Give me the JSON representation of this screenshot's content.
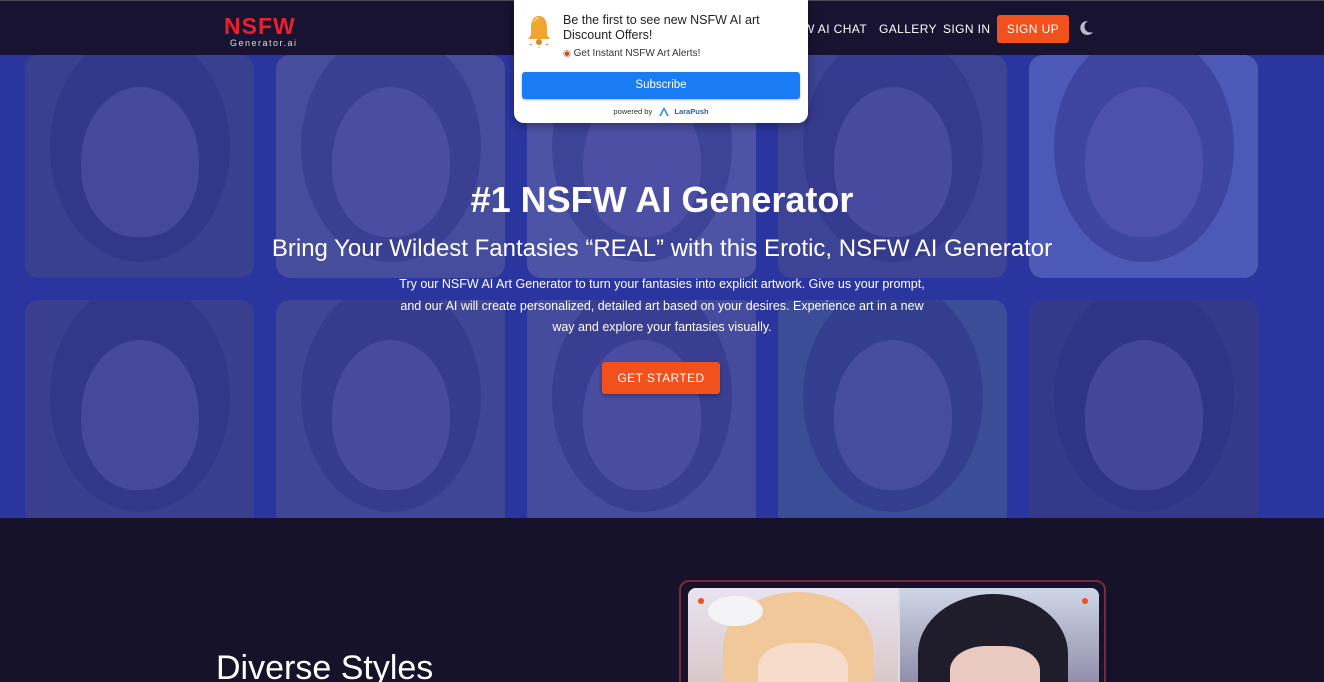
{
  "header": {
    "logo_main": "NSFW",
    "logo_sub": "Generator.ai",
    "nav": {
      "ai_chat": "W AI CHAT",
      "gallery": "GALLERY",
      "sign_in": "SIGN IN"
    },
    "sign_up": "SIGN UP",
    "theme_toggle_icon": "moon-icon"
  },
  "popup": {
    "title": "Be the first to see new NSFW AI art Discount Offers!",
    "subtitle": "Get Instant NSFW Art Alerts!",
    "subscribe_label": "Subscribe",
    "powered_by": "powered by",
    "brand": "LaraPush",
    "icon": "bell-icon"
  },
  "hero": {
    "title": "#1 NSFW AI Generator",
    "subtitle": "Bring Your Wildest Fantasies “REAL” with this Erotic, NSFW AI Generator",
    "description": "Try our NSFW AI Art Generator to turn your fantasies into explicit artwork. Give us your prompt, and our AI will create personalized, detailed art based on your desires. Experience art in a new way and explore your fantasies visually.",
    "cta_label": "GET STARTED"
  },
  "section": {
    "title": "Diverse Styles"
  },
  "colors": {
    "accent": "#f2501d",
    "header_bg": "#171331",
    "page_bg": "#15122a",
    "hero_overlay": "#2c38aa",
    "subscribe_blue": "#1a7cf5",
    "logo_red": "#e8212e"
  }
}
